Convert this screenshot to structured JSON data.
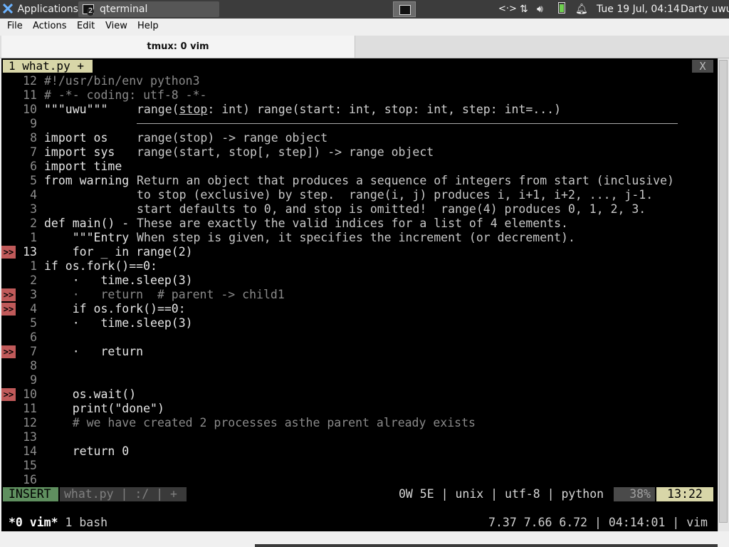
{
  "panel": {
    "applications": "Applications",
    "task_label": "qterminal",
    "task_badge": "2",
    "clock": "Tue 19 Jul, 04:14",
    "user": "Darty uwu"
  },
  "menu": [
    "File",
    "Actions",
    "Edit",
    "View",
    "Help"
  ],
  "tab": {
    "title": "tmux: 0 vim"
  },
  "vim": {
    "tabline": {
      "label": "1 what.py +",
      "close": "X"
    },
    "lines": [
      {
        "num": "12",
        "code": "#!/usr/bin/env python3",
        "kind": "comment"
      },
      {
        "num": "11",
        "code": "# -*- coding: utf-8 -*-",
        "kind": "comment"
      },
      {
        "num": "10",
        "code": "\"\"\"uwu\"\"\"",
        "kind": "code"
      },
      {
        "num": "9",
        "code": "",
        "kind": "code"
      },
      {
        "num": "8",
        "code": "import os",
        "kind": "code"
      },
      {
        "num": "7",
        "code": "import sys",
        "kind": "code"
      },
      {
        "num": "6",
        "code": "import time",
        "kind": "code"
      },
      {
        "num": "5",
        "code": "from warning",
        "kind": "code"
      },
      {
        "num": "4",
        "code": "",
        "kind": "code"
      },
      {
        "num": "3",
        "code": "",
        "kind": "code"
      },
      {
        "num": "2",
        "code": "def main() -",
        "kind": "code"
      },
      {
        "num": "1",
        "code": "    \"\"\"Entry",
        "kind": "code"
      },
      {
        "num": "13",
        "code": "    for _ in range(2)",
        "kind": "current",
        "sign": ">>"
      },
      {
        "num": "1",
        "code": "if os.fork()==0:",
        "kind": "code"
      },
      {
        "num": "2",
        "code": "    ·   time.sleep(3)",
        "kind": "code"
      },
      {
        "num": "3",
        "code": "    ·   return  # parent -> child1",
        "kind": "comment",
        "sign": ">>"
      },
      {
        "num": "4",
        "code": "    if os.fork()==0:",
        "kind": "code",
        "sign": ">>"
      },
      {
        "num": "5",
        "code": "    ·   time.sleep(3)",
        "kind": "code"
      },
      {
        "num": "6",
        "code": "",
        "kind": "code"
      },
      {
        "num": "7",
        "code": "    ·   return",
        "kind": "code",
        "sign": ">>"
      },
      {
        "num": "8",
        "code": "",
        "kind": "code"
      },
      {
        "num": "9",
        "code": "",
        "kind": "code"
      },
      {
        "num": "10",
        "code": "    os.wait()",
        "kind": "code",
        "sign": ">>"
      },
      {
        "num": "11",
        "code": "    print(\"done\")",
        "kind": "code"
      },
      {
        "num": "12",
        "code": "    # we have created 2 processes asthe parent already exists",
        "kind": "comment"
      },
      {
        "num": "13",
        "code": "",
        "kind": "code"
      },
      {
        "num": "14",
        "code": "    return 0",
        "kind": "code"
      },
      {
        "num": "15",
        "code": "",
        "kind": "code"
      },
      {
        "num": "16",
        "code": "",
        "kind": "code"
      }
    ],
    "popup": {
      "signature_prefix": "range(",
      "signature_param": "stop",
      "signature_rest": ": int) range(start: int, stop: int, step: int=...)",
      "lines": [
        "range(stop) -> range object",
        "range(start, stop[, step]) -> range object",
        "",
        "Return an object that produces a sequence of integers from start (inclusive)",
        "to stop (exclusive) by step.  range(i, j) produces i, i+1, i+2, ..., j-1.",
        "start defaults to 0, and stop is omitted!  range(4) produces 0, 1, 2, 3.",
        "These are exactly the valid indices for a list of 4 elements.",
        "When step is given, it specifies the increment (or decrement)."
      ]
    },
    "statusline": {
      "mode": "INSERT",
      "file": "what.py | :/ | +",
      "info": "0W 5E | unix | utf-8 | python",
      "percent": "38%",
      "position": "13:22"
    }
  },
  "tmux": {
    "windows": "*0 vim* 1 bash",
    "status": "7.37 7.66 6.72 | 04:14:01 | vim"
  }
}
